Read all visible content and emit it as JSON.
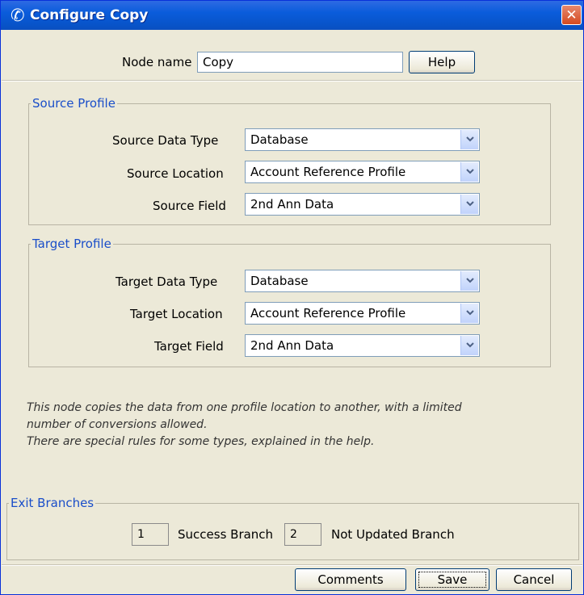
{
  "window": {
    "title": "Configure Copy",
    "close_label": "✕"
  },
  "node": {
    "label": "Node name",
    "value": "Copy",
    "help_label": "Help"
  },
  "source": {
    "legend": "Source Profile",
    "data_type": {
      "label": "Source Data Type",
      "value": "Database"
    },
    "location": {
      "label": "Source Location",
      "value": "Account Reference Profile"
    },
    "field": {
      "label": "Source Field",
      "value": "2nd Ann Data"
    }
  },
  "target": {
    "legend": "Target Profile",
    "data_type": {
      "label": "Target Data Type",
      "value": "Database"
    },
    "location": {
      "label": "Target Location",
      "value": "Account Reference Profile"
    },
    "field": {
      "label": "Target Field",
      "value": "2nd Ann Data"
    }
  },
  "info": {
    "line1": "This node copies the data from one profile location to another, with a limited",
    "line2": "number of conversions allowed.",
    "line3": "There are special rules for some types, explained in the help."
  },
  "exit": {
    "legend": "Exit Branches",
    "success_number": "1",
    "success_label": "Success Branch",
    "not_updated_number": "2",
    "not_updated_label": "Not Updated Branch"
  },
  "buttons": {
    "comments": "Comments",
    "save": "Save",
    "cancel": "Cancel"
  },
  "colors": {
    "titlebar": "#0a5cdb",
    "legend_text": "#1a4ec9",
    "dialog_bg": "#ece9d8"
  },
  "icons": {
    "app": "phone-handset-icon",
    "combo_arrow": "chevron-down-icon",
    "close": "close-icon"
  }
}
